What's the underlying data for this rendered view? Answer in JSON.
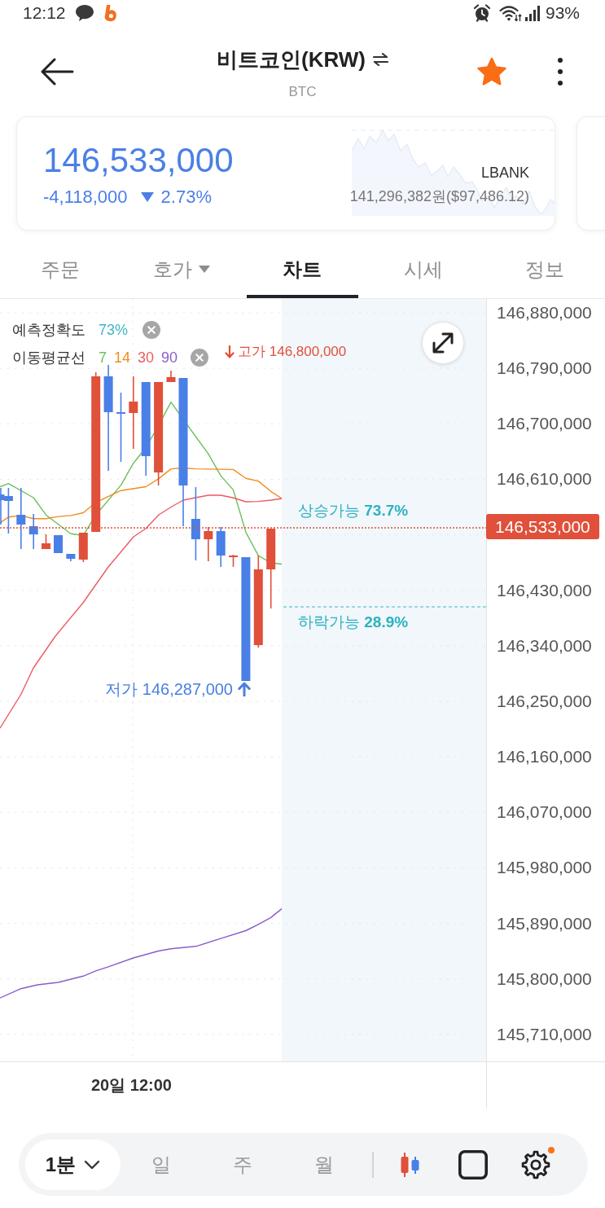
{
  "status_bar": {
    "time": "12:12",
    "battery": "93%"
  },
  "header": {
    "title": "비트코인(KRW)",
    "subtitle": "BTC",
    "favorite": true
  },
  "price_card": {
    "price": "146,533,000",
    "change": "-4,118,000",
    "change_rate": "2.73%",
    "falling": true,
    "exchange": "LBANK",
    "exchange_price": "141,296,382원($97,486.12)"
  },
  "tabs": [
    {
      "label": "주문",
      "selected": false,
      "kind": "plain"
    },
    {
      "label": "호가",
      "selected": false,
      "kind": "dropdown"
    },
    {
      "label": "차트",
      "selected": true,
      "kind": "plain"
    },
    {
      "label": "시세",
      "selected": false,
      "kind": "plain"
    },
    {
      "label": "정보",
      "selected": false,
      "kind": "plain"
    }
  ],
  "chart": {
    "legend": {
      "accuracy_label": "예측정확도",
      "accuracy": "73%",
      "ma_label": "이동평균선",
      "ma_periods": [
        {
          "label": "7",
          "color": "#6cbf5c"
        },
        {
          "label": "14",
          "color": "#f08c1e"
        },
        {
          "label": "30",
          "color": "#ec5a62"
        },
        {
          "label": "90",
          "color": "#8b5cc9"
        }
      ]
    },
    "high_label": "고가 146,800,000",
    "up_prediction": "상승가능 **73.7%**",
    "down_prediction": "하락가능 **28.9%**",
    "low_label": "저가 146,287,000",
    "y_axis": [
      "146,880,000",
      "146,790,000",
      "146,700,000",
      "146,610,000",
      "146,430,000",
      "146,340,000",
      "146,250,000",
      "146,160,000",
      "146,070,000",
      "145,980,000",
      "145,890,000",
      "145,800,000",
      "145,710,000"
    ],
    "current_price": "146,533,000",
    "x_axis": [
      "20일 12:00"
    ]
  },
  "toolbar": {
    "interval": "1분",
    "periods": [
      {
        "label": "일",
        "selected": false
      },
      {
        "label": "주",
        "selected": false
      },
      {
        "label": "월",
        "selected": false
      }
    ],
    "settings_badge": true
  }
}
